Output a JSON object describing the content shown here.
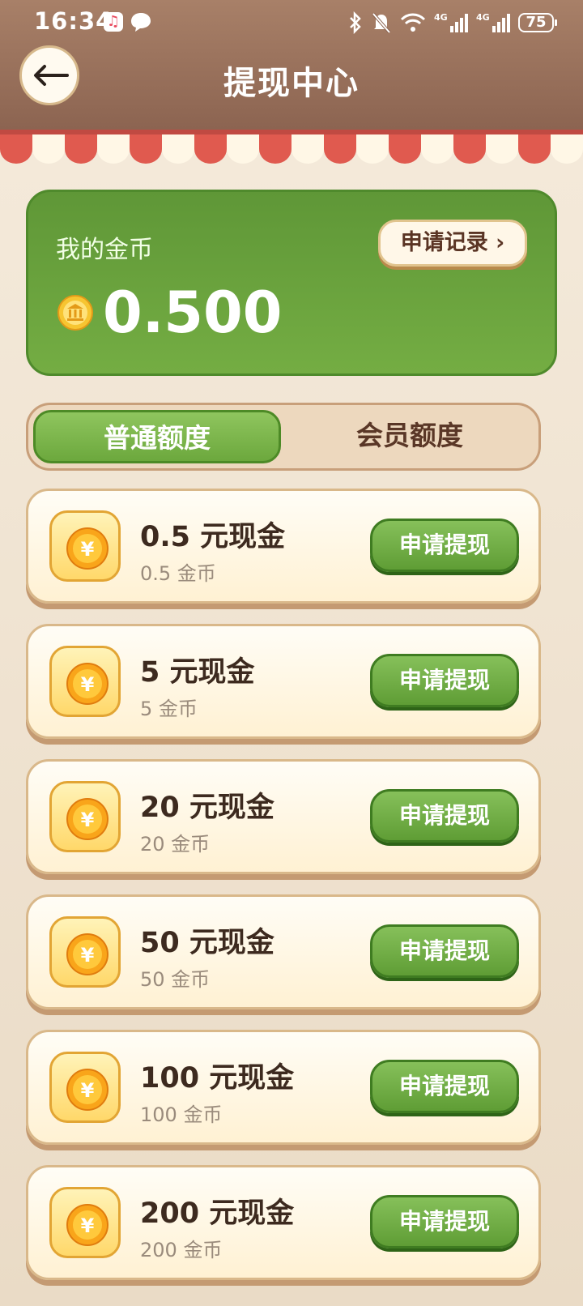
{
  "status_bar": {
    "time": "16:34",
    "battery": "75"
  },
  "header": {
    "title": "提现中心"
  },
  "balance": {
    "label": "我的金币",
    "value": "0.500",
    "record_button": "申请记录 ›"
  },
  "tabs": [
    {
      "label": "普通额度",
      "active": true
    },
    {
      "label": "会员额度",
      "active": false
    }
  ],
  "items": [
    {
      "title": "0.5 元现金",
      "sub": "0.5 金币",
      "button": "申请提现"
    },
    {
      "title": "5 元现金",
      "sub": "5 金币",
      "button": "申请提现"
    },
    {
      "title": "20 元现金",
      "sub": "20 金币",
      "button": "申请提现"
    },
    {
      "title": "50 元现金",
      "sub": "50 金币",
      "button": "申请提现"
    },
    {
      "title": "100 元现金",
      "sub": "100 金币",
      "button": "申请提现"
    },
    {
      "title": "200 元现金",
      "sub": "200 金币",
      "button": "申请提现"
    }
  ],
  "colors": {
    "header": "#8b6350",
    "card_green": "#6ca83d",
    "awning_red": "#e05a4f",
    "text_dark": "#3d2a1f"
  }
}
